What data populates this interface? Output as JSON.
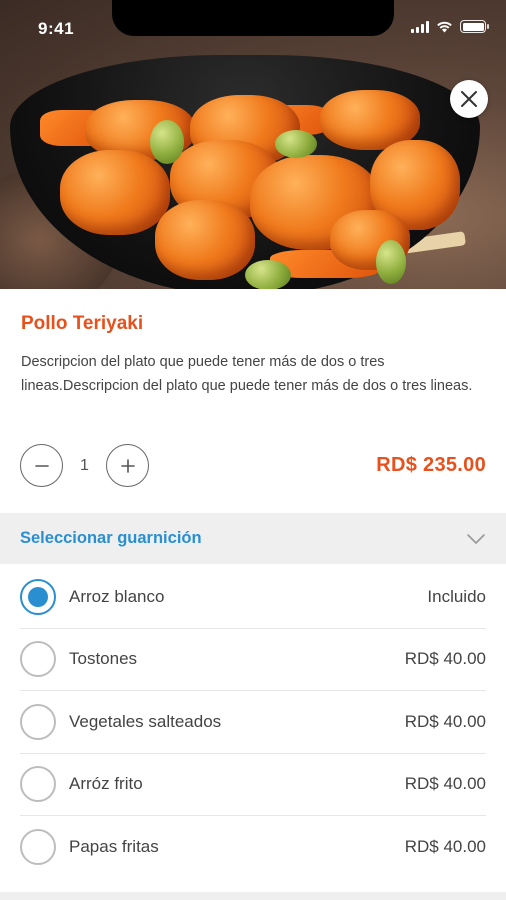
{
  "status_bar": {
    "time": "9:41"
  },
  "hero": {
    "image": "teriyaki-chicken-bowl-photo",
    "close_icon": "close-icon"
  },
  "dish": {
    "title": "Pollo Teriyaki",
    "description": "Descripcion del plato que puede tener más de dos o tres lineas.Descripcion del plato que puede tener más de dos o tres  lineas.",
    "price": "RD$ 235.00"
  },
  "quantity": {
    "value": "1",
    "decrement_icon": "minus-icon",
    "increment_icon": "plus-icon"
  },
  "side_section": {
    "title": "Seleccionar guarnición",
    "toggle_icon": "chevron-down-icon",
    "options": [
      {
        "name": "Arroz blanco",
        "price": "Incluido",
        "selected": true
      },
      {
        "name": "Tostones",
        "price": "RD$ 40.00",
        "selected": false
      },
      {
        "name": "Vegetales salteados",
        "price": "RD$ 40.00",
        "selected": false
      },
      {
        "name": "Arróz frito",
        "price": "RD$ 40.00",
        "selected": false
      },
      {
        "name": "Papas fritas",
        "price": "RD$ 40.00",
        "selected": false
      }
    ]
  },
  "colors": {
    "accent": "#e8501c",
    "primary": "#2a8fd0",
    "section_bg": "#efefef"
  }
}
